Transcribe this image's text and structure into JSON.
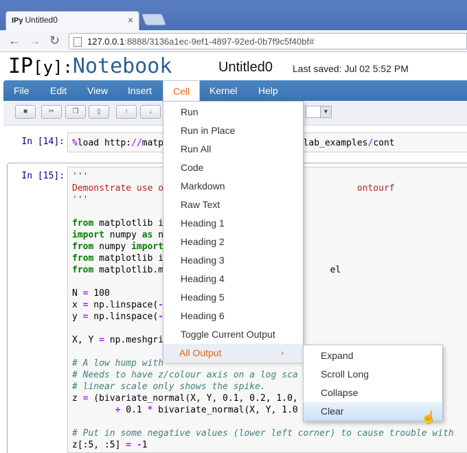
{
  "browser": {
    "tab_title": "Untitled0",
    "tab_icon": "IPy",
    "url_host": "127.0.0.1",
    "url_rest": ":8888/3136a1ec-9ef1-4897-92ed-0b7f9c5f40bf#"
  },
  "header": {
    "logo_ip": "IP",
    "logo_y": "[y]:",
    "logo_notebook": "Notebook",
    "notebook_name": "Untitled0",
    "last_saved": "Last saved: Jul 02 5:52 PM"
  },
  "menubar": {
    "items": [
      "File",
      "Edit",
      "View",
      "Insert",
      "Cell",
      "Kernel",
      "Help"
    ]
  },
  "cells": [
    {
      "prompt": "In [14]:",
      "code": "%load http://matplotlib.org/mpl_examples/pylab_examples/cont"
    },
    {
      "prompt": "In [15]:"
    }
  ],
  "cell_menu": {
    "items": [
      "Run",
      "Run in Place",
      "Run All",
      "Code",
      "Markdown",
      "Raw Text",
      "Heading 1",
      "Heading 2",
      "Heading 3",
      "Heading 4",
      "Heading 5",
      "Heading 6",
      "Toggle Current Output"
    ],
    "submenu_label": "All Output"
  },
  "all_output_menu": {
    "items": [
      "Expand",
      "Scroll Long",
      "Collapse",
      "Clear"
    ]
  },
  "colors": {
    "menubar": "#3a73b0",
    "accent": "#e0640d"
  }
}
